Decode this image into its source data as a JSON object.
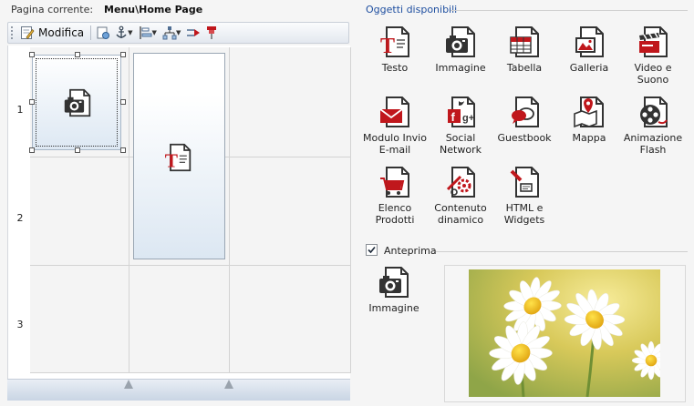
{
  "header": {
    "current_page_label": "Pagina corrente:",
    "current_page_value": "Menu\\Home Page"
  },
  "toolbar": {
    "edit_label": "Modifica",
    "tools": [
      "properties-icon",
      "anchor-icon",
      "align-icon",
      "hierarchy-icon",
      "move-right-icon",
      "pin-icon"
    ]
  },
  "grid": {
    "rows": [
      "1",
      "2",
      "3"
    ],
    "columns": 3,
    "objects": [
      {
        "type": "image",
        "icon": "camera-icon",
        "row": 1,
        "col": 1,
        "selected": true
      },
      {
        "type": "text",
        "icon": "text-icon",
        "row": "1-2",
        "col": 2,
        "selected": false
      }
    ],
    "slider_thumbs": 2
  },
  "available_objects": {
    "title": "Oggetti disponibili",
    "items": [
      {
        "label": "Testo",
        "icon": "text-icon"
      },
      {
        "label": "Immagine",
        "icon": "camera-icon"
      },
      {
        "label": "Tabella",
        "icon": "table-icon"
      },
      {
        "label": "Galleria",
        "icon": "gallery-icon"
      },
      {
        "label": "Video e Suono",
        "icon": "clapperboard-icon"
      },
      {
        "label": "Modulo Invio E-mail",
        "icon": "envelope-icon"
      },
      {
        "label": "Social Network",
        "icon": "social-icon"
      },
      {
        "label": "Guestbook",
        "icon": "speech-bubble-icon"
      },
      {
        "label": "Mappa",
        "icon": "map-pin-icon"
      },
      {
        "label": "Animazione Flash",
        "icon": "film-reel-icon"
      },
      {
        "label": "Elenco Prodotti",
        "icon": "cart-icon"
      },
      {
        "label": "Contenuto dinamico",
        "icon": "gears-icon"
      },
      {
        "label": "HTML e Widgets",
        "icon": "html-icon"
      }
    ]
  },
  "preview": {
    "label": "Anteprima",
    "checked": true,
    "selected_object_label": "Immagine",
    "selected_object_icon": "camera-icon",
    "image_subject": "daisies-photo"
  },
  "colors": {
    "accent_red": "#c0171c",
    "section_title": "#1f4fa0",
    "selection_gradient_end": "#dde8f3"
  }
}
